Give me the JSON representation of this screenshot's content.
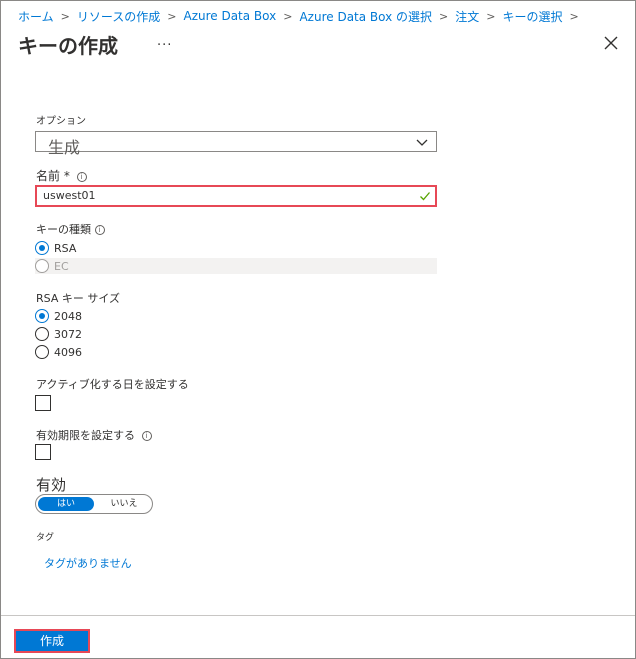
{
  "breadcrumb": [
    {
      "label": "ホーム"
    },
    {
      "label": "リソースの作成"
    },
    {
      "label": "Azure Data Box"
    },
    {
      "label": "Azure Data Box の選択"
    },
    {
      "label": "注文"
    },
    {
      "label": "キーの選択"
    }
  ],
  "header": {
    "title": "キーの作成",
    "more": "..."
  },
  "form": {
    "options": {
      "label": "オプション",
      "value": "生成"
    },
    "name": {
      "label": "名前 *",
      "value": "uswest01"
    },
    "key_type": {
      "label": "キーの種類",
      "options": [
        {
          "label": "RSA",
          "selected": true,
          "disabled": false
        },
        {
          "label": "EC",
          "selected": false,
          "disabled": true
        }
      ]
    },
    "rsa_size": {
      "label": "RSA キー サイズ",
      "options": [
        {
          "label": "2048",
          "selected": true
        },
        {
          "label": "3072",
          "selected": false
        },
        {
          "label": "4096",
          "selected": false
        }
      ]
    },
    "activation": {
      "label": "アクティブ化する日を設定する",
      "checked": false
    },
    "expiration": {
      "label": "有効期限を設定する",
      "checked": false
    },
    "enabled": {
      "label": "有効",
      "on_label": "はい",
      "off_label": "いいえ",
      "value": "はい"
    },
    "tags": {
      "label": "タグ",
      "empty_text": "タグがありません"
    }
  },
  "footer": {
    "create_label": "作成"
  },
  "colors": {
    "accent": "#0078d4",
    "highlight": "#e74856",
    "success": "#57a300"
  }
}
